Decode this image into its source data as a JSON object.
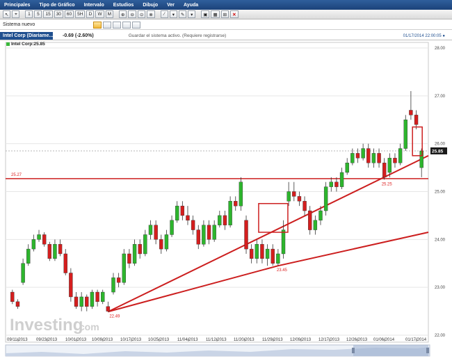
{
  "menu": [
    "Principales",
    "Tipo de Gráfico",
    "Intervalo",
    "Estudios",
    "Dibujo",
    "Ver",
    "Ayuda"
  ],
  "toolbar": {
    "intervals": [
      "1",
      "5",
      "15",
      "30",
      "60",
      "5H",
      "D",
      "W",
      "M"
    ],
    "cursor_glyph": "↖"
  },
  "system": {
    "label": "Sistema nuevo"
  },
  "instrument": {
    "tab": "Intel Corp (Diariame...",
    "change": "-0.69 (-2.60%)",
    "save_notice": "Guardar el sistema activo. (Requiere registrarse)",
    "timestamp": "01/17/2014 22:00:05 ●",
    "series_label": "Intel Corp:25.85"
  },
  "colors": {
    "up": "#2db52d",
    "down": "#d41e1e",
    "line": "#cc1e1e",
    "brand_blue": "#1f4f8f"
  },
  "watermark": {
    "text": "Investing",
    "suffix": ".com"
  },
  "chart_data": {
    "type": "candlestick",
    "ylim": [
      22.0,
      28.0
    ],
    "yticks": [
      "28.00",
      "27.00",
      "26.00",
      "25.00",
      "24.00",
      "23.00",
      "22.00"
    ],
    "x_labels": [
      "09/11/2013",
      "09/23/2013",
      "10/01/2013",
      "10/09/2013",
      "10/17/2013",
      "10/25/2013",
      "11/04/2013",
      "11/12/2013",
      "11/20/2013",
      "11/29/2013",
      "12/09/2013",
      "12/17/2013",
      "12/26/2013",
      "01/06/2014",
      "01/17/2014"
    ],
    "last_price": "25.85",
    "horizontal_level": {
      "value": 25.27,
      "label": "25.27"
    },
    "annotations": [
      {
        "text": "22.49",
        "value": 22.49
      },
      {
        "text": "23.45",
        "value": 23.45
      },
      {
        "text": "25.25",
        "value": 25.25
      }
    ],
    "candles": [
      [
        22.9,
        22.7,
        22.95,
        22.65
      ],
      [
        22.7,
        22.6,
        22.75,
        22.55
      ],
      [
        23.1,
        23.5,
        23.6,
        23.05
      ],
      [
        23.5,
        23.8,
        23.9,
        23.45
      ],
      [
        23.8,
        24.0,
        24.1,
        23.75
      ],
      [
        24.0,
        24.1,
        24.2,
        23.95
      ],
      [
        24.1,
        23.9,
        24.15,
        23.85
      ],
      [
        23.9,
        23.6,
        23.95,
        23.55
      ],
      [
        23.6,
        23.9,
        24.0,
        23.55
      ],
      [
        23.9,
        23.7,
        24.0,
        23.65
      ],
      [
        23.7,
        23.3,
        23.8,
        23.25
      ],
      [
        23.3,
        22.8,
        23.4,
        22.7
      ],
      [
        22.8,
        22.6,
        22.9,
        22.55
      ],
      [
        22.6,
        22.8,
        22.9,
        22.5
      ],
      [
        22.8,
        22.6,
        22.85,
        22.5
      ],
      [
        22.6,
        22.9,
        22.95,
        22.55
      ],
      [
        22.9,
        22.7,
        22.95,
        22.6
      ],
      [
        22.7,
        22.9,
        22.95,
        22.65
      ],
      [
        22.6,
        22.5,
        22.7,
        22.49
      ],
      [
        22.9,
        23.2,
        23.3,
        22.85
      ],
      [
        23.2,
        23.1,
        23.3,
        23.0
      ],
      [
        23.1,
        23.7,
        23.8,
        23.05
      ],
      [
        23.7,
        23.5,
        23.8,
        23.4
      ],
      [
        23.5,
        23.9,
        24.0,
        23.45
      ],
      [
        23.9,
        23.7,
        24.0,
        23.6
      ],
      [
        23.7,
        24.1,
        24.2,
        23.65
      ],
      [
        24.1,
        24.3,
        24.4,
        24.0
      ],
      [
        24.3,
        24.0,
        24.4,
        23.9
      ],
      [
        24.0,
        23.8,
        24.1,
        23.7
      ],
      [
        23.8,
        24.1,
        24.2,
        23.75
      ],
      [
        24.1,
        24.4,
        24.5,
        24.05
      ],
      [
        24.4,
        24.7,
        24.8,
        24.35
      ],
      [
        24.7,
        24.5,
        24.8,
        24.4
      ],
      [
        24.5,
        24.4,
        24.7,
        24.3
      ],
      [
        24.4,
        24.2,
        24.5,
        24.1
      ],
      [
        24.2,
        23.9,
        24.3,
        23.8
      ],
      [
        23.9,
        24.3,
        24.4,
        23.85
      ],
      [
        24.3,
        24.0,
        24.4,
        23.9
      ],
      [
        24.0,
        24.3,
        24.4,
        23.95
      ],
      [
        24.3,
        24.5,
        24.6,
        24.25
      ],
      [
        24.5,
        24.3,
        24.6,
        24.2
      ],
      [
        24.3,
        24.8,
        24.9,
        24.25
      ],
      [
        24.8,
        24.7,
        24.9,
        24.6
      ],
      [
        24.7,
        25.2,
        25.3,
        24.6
      ],
      [
        24.4,
        23.8,
        24.5,
        23.7
      ],
      [
        23.8,
        23.6,
        23.9,
        23.5
      ],
      [
        23.6,
        23.9,
        24.0,
        23.5
      ],
      [
        23.9,
        23.6,
        24.0,
        23.5
      ],
      [
        23.6,
        23.8,
        23.9,
        23.45
      ],
      [
        23.8,
        23.5,
        23.9,
        23.45
      ],
      [
        23.5,
        23.7,
        23.8,
        23.45
      ],
      [
        23.7,
        24.2,
        24.4,
        23.6
      ],
      [
        24.8,
        25.0,
        25.2,
        24.7
      ],
      [
        25.0,
        24.9,
        25.2,
        24.8
      ],
      [
        24.9,
        24.8,
        25.0,
        24.7
      ],
      [
        24.8,
        24.6,
        24.9,
        24.5
      ],
      [
        24.6,
        24.2,
        24.7,
        24.1
      ],
      [
        24.2,
        24.4,
        24.5,
        24.1
      ],
      [
        24.4,
        24.6,
        24.7,
        24.3
      ],
      [
        24.6,
        25.1,
        25.2,
        24.5
      ],
      [
        25.1,
        25.2,
        25.3,
        25.0
      ],
      [
        25.2,
        25.1,
        25.3,
        25.0
      ],
      [
        25.1,
        25.4,
        25.5,
        25.05
      ],
      [
        25.4,
        25.6,
        25.7,
        25.35
      ],
      [
        25.6,
        25.8,
        25.9,
        25.55
      ],
      [
        25.8,
        25.7,
        25.9,
        25.6
      ],
      [
        25.7,
        25.9,
        26.0,
        25.65
      ],
      [
        25.9,
        25.6,
        26.0,
        25.5
      ],
      [
        25.6,
        25.8,
        25.9,
        25.5
      ],
      [
        25.8,
        25.6,
        25.9,
        25.5
      ],
      [
        25.6,
        25.3,
        25.7,
        25.25
      ],
      [
        25.4,
        25.7,
        25.8,
        25.3
      ],
      [
        25.7,
        25.6,
        25.8,
        25.5
      ],
      [
        25.6,
        25.9,
        26.0,
        25.55
      ],
      [
        25.9,
        26.5,
        26.6,
        25.85
      ],
      [
        26.7,
        26.6,
        27.1,
        26.5
      ],
      [
        26.6,
        26.4,
        26.7,
        26.3
      ],
      [
        25.5,
        25.85,
        25.9,
        25.3
      ]
    ]
  }
}
